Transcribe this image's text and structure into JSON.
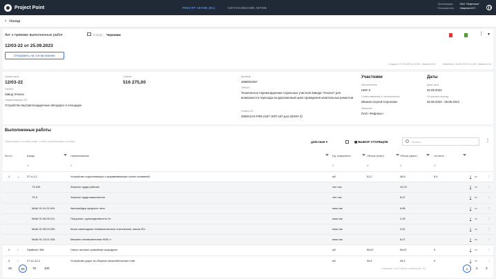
{
  "app": {
    "title": "Project Point"
  },
  "nav": {
    "tabs": [
      {
        "label": "РЕЕСТР АКТОВ (КС)",
        "active": true
      },
      {
        "label": "СОГЛАСОВАНИЕ АКТОВ",
        "active": false
      }
    ]
  },
  "user": {
    "org_label": "Организация:",
    "org_value": "ПАО \"Нефтехим\"",
    "user_label": "Пользователь:",
    "user_value": "Смирнов М.П."
  },
  "back": {
    "label": "Назад"
  },
  "doc": {
    "title": "Акт о приемке выполненных работ",
    "status_label": "Статус:",
    "status_value": "Черновик",
    "number": "12/03-22 от 25.09.2023",
    "send_button": "Отправить на согласование",
    "created": "Создано: 07.09.2023 в 13:08 - Иванов И.И.",
    "modified": "Изменено: 28.09.2023 в 11:08 - Иванов И.И."
  },
  "details": {
    "act_no_label": "Номер акта",
    "act_no": "12/03-22",
    "project_label": "Проект",
    "project": "Завод Эталон",
    "ls_name_label": "Наименование ЛС",
    "ls_name": "Устройство внутриплощадочных автодорог и площадок",
    "sum_label": "Сумма",
    "sum": "516 275,00",
    "contract_label": "Договор",
    "contract": "4568003457",
    "object_label": "Объект",
    "object": "Техническое перевооружение отдельных участков Завода \"Эталон\" для возможности перехода на двухсменный цикл проведения капитальных ремонтов",
    "ls_no_label": "Номер ЛС",
    "ls_no": "2900013-5-РФ5-2187-ЭПП-187.доп.2(НМУ-3)",
    "participants_title": "Участники",
    "executor_label": "Исполнитель",
    "executor": "НМУ-3",
    "responsible_label": "Ответственный от исполнителя",
    "responsible": "Иванов Сергей Сергеевич",
    "customer_label": "Заказчик",
    "customer": "ПАО «Рефлекс»",
    "dates_title": "Даты",
    "act_date_label": "Дата акта",
    "act_date": "25.09.2023",
    "period_label": "Отчетный период",
    "period": "26.08.2023 - 25.09.2023"
  },
  "works": {
    "title": "Выполненные работы",
    "drag_hint": "Перетащите столбец сюда, чтобы сгруппировать по нему",
    "actions_label": "действия",
    "columns_button": "ВЫБОР СТОЛБЦОВ",
    "search_placeholder": "Искать...",
    "columns": [
      "№ п/п",
      "Шифр",
      "Наименование",
      "Ед. измерения",
      "Объем (план)",
      "Объем (факт)",
      "Остаток"
    ],
    "rows": [
      {
        "no": "1",
        "exp": "⌄",
        "code": "27-4-1-2",
        "name": "Устройство подстилающих и выравнивающих слоев оснований",
        "unit": "м3",
        "plan": "51,2",
        "fact": "45,8",
        "rest": "5,4",
        "sub": false,
        "cnt": "2"
      },
      {
        "no": "",
        "exp": "",
        "code": "Т3-333",
        "name": "Затраты труда рабочих",
        "unit": "чел час",
        "plan": "",
        "fact": "10,23",
        "rest": "",
        "sub": true,
        "cnt": "2"
      },
      {
        "no": "",
        "exp": "",
        "code": "Т3-3",
        "name": "Затраты труда машинистов",
        "unit": "чел час",
        "plan": "",
        "fact": "8,47",
        "rest": "",
        "sub": true,
        "cnt": "2"
      },
      {
        "no": "",
        "exp": "",
        "code": "МАШ 91.01.02-004",
        "name": "Автогрейдер среднего типа",
        "unit": "маш час",
        "plan": "",
        "fact": "6,88",
        "rest": "",
        "sub": true,
        "cnt": "2"
      },
      {
        "no": "",
        "exp": "",
        "code": "МАШ 91.08.05-011",
        "name": "Погрузчик, грузоподъемность 5т.",
        "unit": "маш час",
        "plan": "",
        "fact": "2,18",
        "rest": "",
        "sub": true,
        "cnt": "2"
      },
      {
        "no": "",
        "exp": "",
        "code": "МАШ 91.08.03-030",
        "name": "Катки самоходные пневмоколесные статические, масса 30т.",
        "unit": "маш час",
        "plan": "",
        "fact": "3,24",
        "rest": "",
        "sub": true,
        "cnt": "2"
      },
      {
        "no": "",
        "exp": "",
        "code": "МАШ 91.13.01-038",
        "name": "Машины поливомоечные 6000 л",
        "unit": "маш час",
        "plan": "",
        "fact": "8,47",
        "rest": "",
        "sub": true,
        "cnt": "2"
      },
      {
        "no": "2",
        "exp": "›",
        "code": "Прайсинг 386",
        "name": "Смесь песчано-гравийная природная",
        "unit": "м3",
        "plan": "54,87",
        "fact": "55,87",
        "rest": "0",
        "sub": false,
        "cnt": "2"
      },
      {
        "no": "3",
        "exp": "›",
        "code": "27-12-10-2",
        "name": "Устройство дорог из сборных железобетонных плит",
        "unit": "м3",
        "plan": "34,4",
        "fact": "34,4",
        "rest": "0",
        "sub": false,
        "cnt": "2"
      }
    ],
    "page_sizes": [
      "25",
      "50",
      "75",
      "100"
    ],
    "page_size_selected": "50",
    "page_info": "Страница 1 из 3 (Всего элементов: 10)",
    "pages": [
      "1",
      "2",
      "3"
    ],
    "page_selected": "1"
  },
  "colors": {
    "topbar": "#1f2a36",
    "accent": "#3b73d4",
    "pdf": "#d63b3b",
    "xls": "#4f9d3a"
  }
}
